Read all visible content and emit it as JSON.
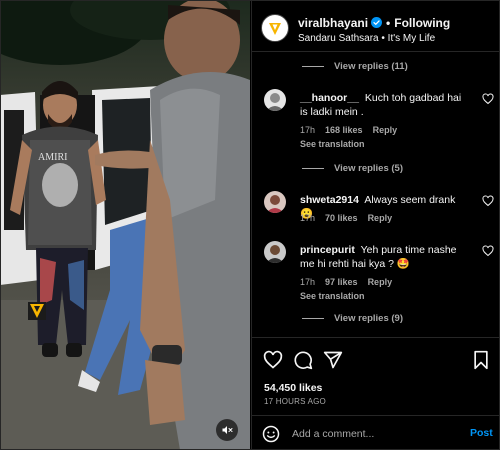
{
  "header": {
    "username": "viralbhayani",
    "follow_state": "Following",
    "subtitle": "Sandaru Sathsara • It's My Life",
    "icons": {
      "avatar": "viral-bhayani-logo",
      "verified": "verified-badge-icon"
    }
  },
  "comments": {
    "thread": [
      {
        "type": "view_replies",
        "label": "View replies (11)"
      },
      {
        "type": "comment",
        "username": "__hanoor__",
        "text": "Kuch toh gadbad hai is ladki mein .",
        "time": "17h",
        "likes": "168 likes",
        "reply": "Reply",
        "translation": "See translation"
      },
      {
        "type": "view_replies",
        "label": "View replies (5)"
      },
      {
        "type": "comment",
        "username": "shweta2914",
        "text": "Always seem drank 😮",
        "time": "17h",
        "likes": "70 likes",
        "reply": "Reply"
      },
      {
        "type": "comment",
        "username": "princepurit",
        "text": "Yeh pura time nashe me hi rehti hai kya ? 🤩",
        "time": "17h",
        "likes": "97 likes",
        "reply": "Reply",
        "translation": "See translation"
      },
      {
        "type": "view_replies",
        "label": "View replies (9)"
      }
    ]
  },
  "actions": {
    "icons": [
      "heart-icon",
      "comment-icon",
      "share-icon",
      "bookmark-icon"
    ],
    "likes": "54,450 likes",
    "date": "17 HOURS AGO"
  },
  "composer": {
    "placeholder": "Add a comment...",
    "post_label": "Post"
  },
  "media": {
    "mute_icon": "speaker-muted-icon",
    "watermark": "viral-bhayani-watermark"
  },
  "colors": {
    "background": "#000000",
    "text": "#f5f5f5",
    "secondary": "#a8a8a8",
    "link": "#0095f6",
    "border": "#262626",
    "brand": "#f7b500"
  }
}
